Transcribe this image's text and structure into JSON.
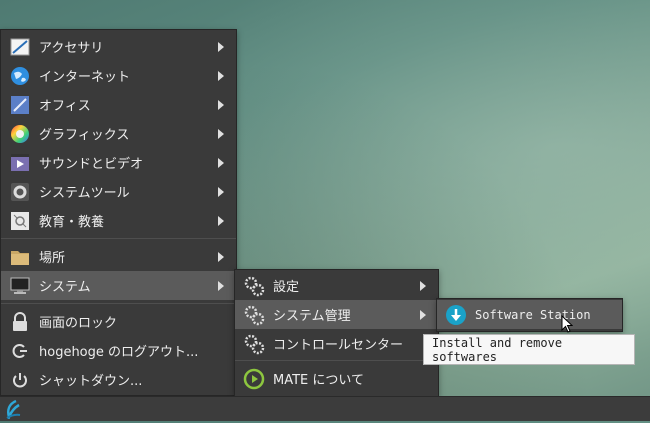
{
  "menu": {
    "items": [
      {
        "label": "アクセサリ",
        "icon": "accessories-icon"
      },
      {
        "label": "インターネット",
        "icon": "internet-globe-icon"
      },
      {
        "label": "オフィス",
        "icon": "office-icon"
      },
      {
        "label": "グラフィックス",
        "icon": "graphics-color-wheel-icon"
      },
      {
        "label": "サウンドとビデオ",
        "icon": "sound-video-icon"
      },
      {
        "label": "システムツール",
        "icon": "system-tools-icon"
      },
      {
        "label": "教育・教養",
        "icon": "education-icon"
      }
    ],
    "places": {
      "label": "場所",
      "icon": "folder-icon"
    },
    "system": {
      "label": "システム",
      "icon": "monitor-icon"
    },
    "lock": {
      "label": "画面のロック",
      "icon": "lock-icon"
    },
    "logout": {
      "label": "hogehoge のログアウト...",
      "icon": "logout-icon"
    },
    "shutdown": {
      "label": "シャットダウン...",
      "icon": "power-icon"
    }
  },
  "system_submenu": {
    "settings": "設定",
    "admin": "システム管理",
    "control_center": "コントロールセンター",
    "about": "MATE について"
  },
  "admin_submenu": {
    "software_station": "Software Station"
  },
  "tooltip": "Install and remove softwares",
  "colors": {
    "menu_bg": "#3a3a3a",
    "highlight": "#5b5b5b",
    "accent": "#1aa2c8"
  }
}
